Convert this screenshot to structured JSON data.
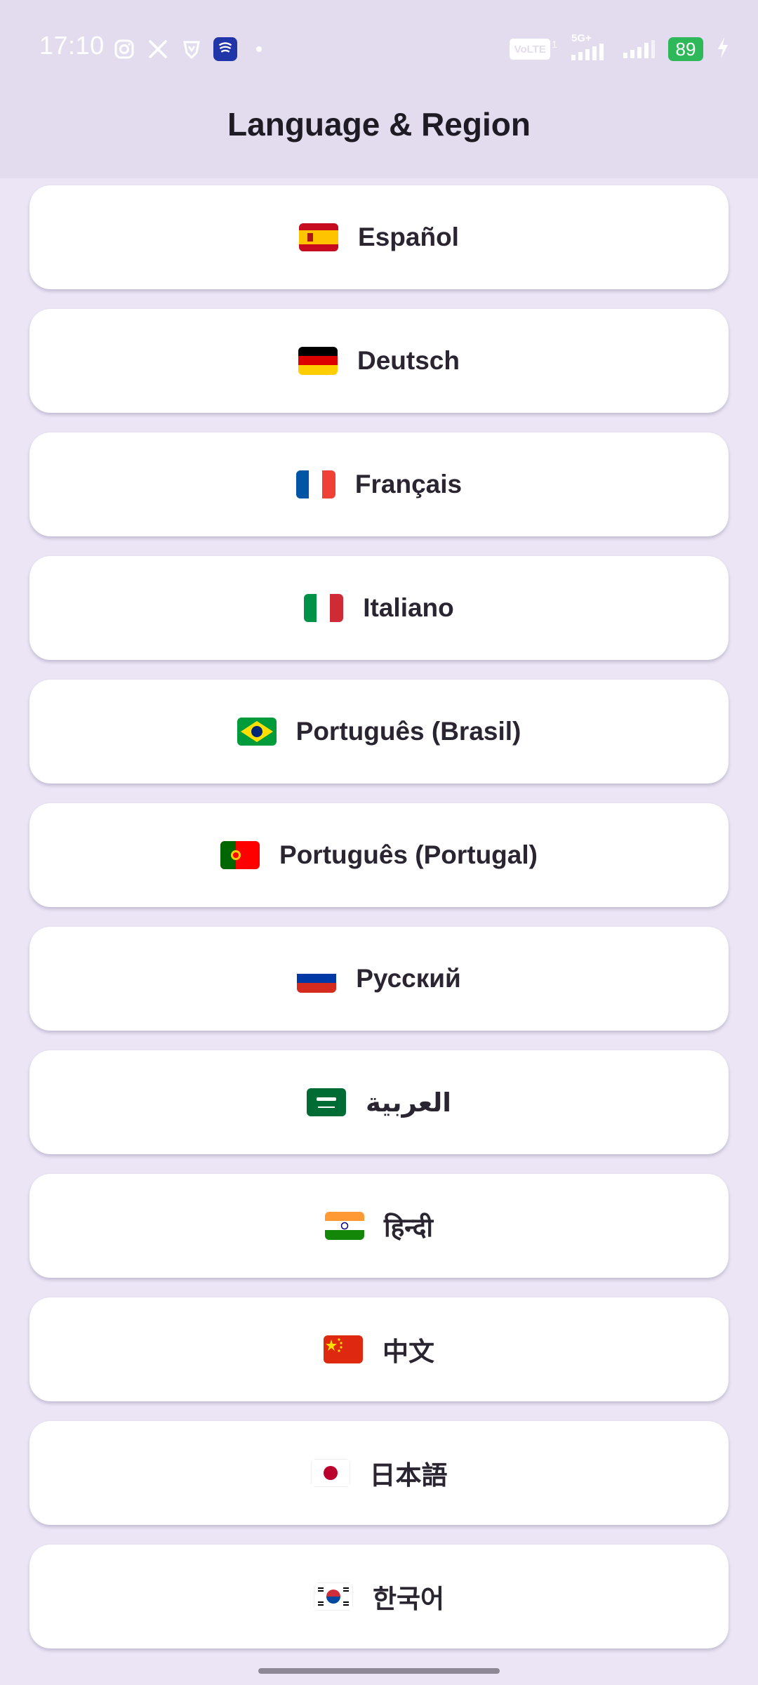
{
  "status_bar": {
    "time": "17:10",
    "left_icons": [
      "instagram-icon",
      "x-icon",
      "vpn-shield-icon",
      "app-icon",
      "dot-icon"
    ],
    "volte": "VoLTE",
    "volte_sim": "1",
    "network": "5G+",
    "battery": "89"
  },
  "app_bar": {
    "title": "Language & Region"
  },
  "languages": [
    {
      "label": "Español",
      "flag": "es-flag-icon"
    },
    {
      "label": "Deutsch",
      "flag": "de-flag-icon"
    },
    {
      "label": "Français",
      "flag": "fr-flag-icon"
    },
    {
      "label": "Italiano",
      "flag": "it-flag-icon"
    },
    {
      "label": "Português (Brasil)",
      "flag": "br-flag-icon"
    },
    {
      "label": "Português (Portugal)",
      "flag": "pt-flag-icon"
    },
    {
      "label": "Русский",
      "flag": "ru-flag-icon"
    },
    {
      "label": "العربية",
      "flag": "sa-flag-icon"
    },
    {
      "label": "हिन्दी",
      "flag": "in-flag-icon"
    },
    {
      "label": "中文",
      "flag": "cn-flag-icon"
    },
    {
      "label": "日本語",
      "flag": "jp-flag-icon"
    },
    {
      "label": "한국어",
      "flag": "kr-flag-icon"
    }
  ],
  "colors": {
    "app_bar_bg": "#e3dcee",
    "page_bg": "#ebe5f5",
    "card_bg": "#ffffff",
    "text": "#1f1b24",
    "battery": "#2fb85a"
  }
}
